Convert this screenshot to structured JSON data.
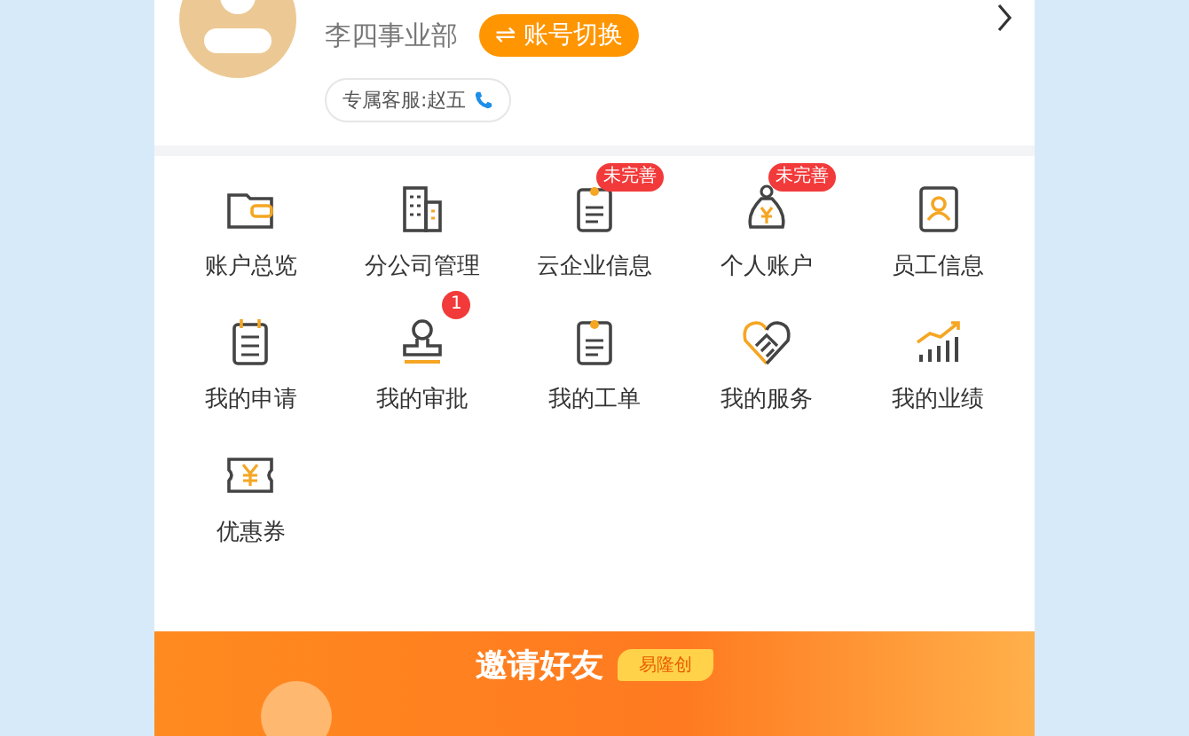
{
  "profile": {
    "department": "李四事业部",
    "switch_button": "⇌ 账号切换",
    "service": "专属客服:赵五"
  },
  "menu": [
    {
      "label": "账户总览"
    },
    {
      "label": "分公司管理"
    },
    {
      "label": "云企业信息",
      "badge": {
        "kind": "tag",
        "text": "未完善"
      }
    },
    {
      "label": "个人账户",
      "badge": {
        "kind": "tag",
        "text": "未完善"
      }
    },
    {
      "label": "员工信息"
    },
    {
      "label": "我的申请"
    },
    {
      "label": "我的审批",
      "badge": {
        "kind": "count",
        "text": "1"
      }
    },
    {
      "label": "我的工单"
    },
    {
      "label": "我的服务"
    },
    {
      "label": "我的业绩"
    },
    {
      "label": "优惠券"
    }
  ],
  "banner": {
    "title": "邀请好友",
    "tag": "易隆创"
  }
}
